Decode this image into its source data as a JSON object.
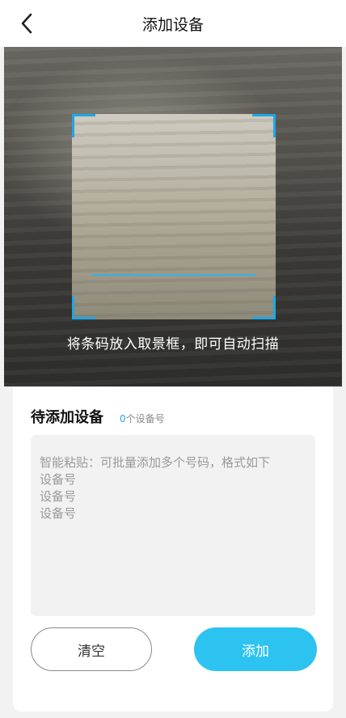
{
  "header": {
    "title": "添加设备",
    "back_icon": "chevron-left-icon"
  },
  "scanner": {
    "hint": "将条码放入取景框，即可自动扫描",
    "frame_color": "#1ea7e8"
  },
  "pending": {
    "title": "待添加设备",
    "count": "0",
    "count_suffix": "个设备号"
  },
  "paste": {
    "placeholder": "智能粘贴：可批量添加多个号码，格式如下\n设备号\n设备号\n设备号",
    "value": ""
  },
  "buttons": {
    "clear_label": "清空",
    "add_label": "添加"
  },
  "colors": {
    "accent": "#2cc3f0",
    "count_accent": "#1ea7e8"
  }
}
